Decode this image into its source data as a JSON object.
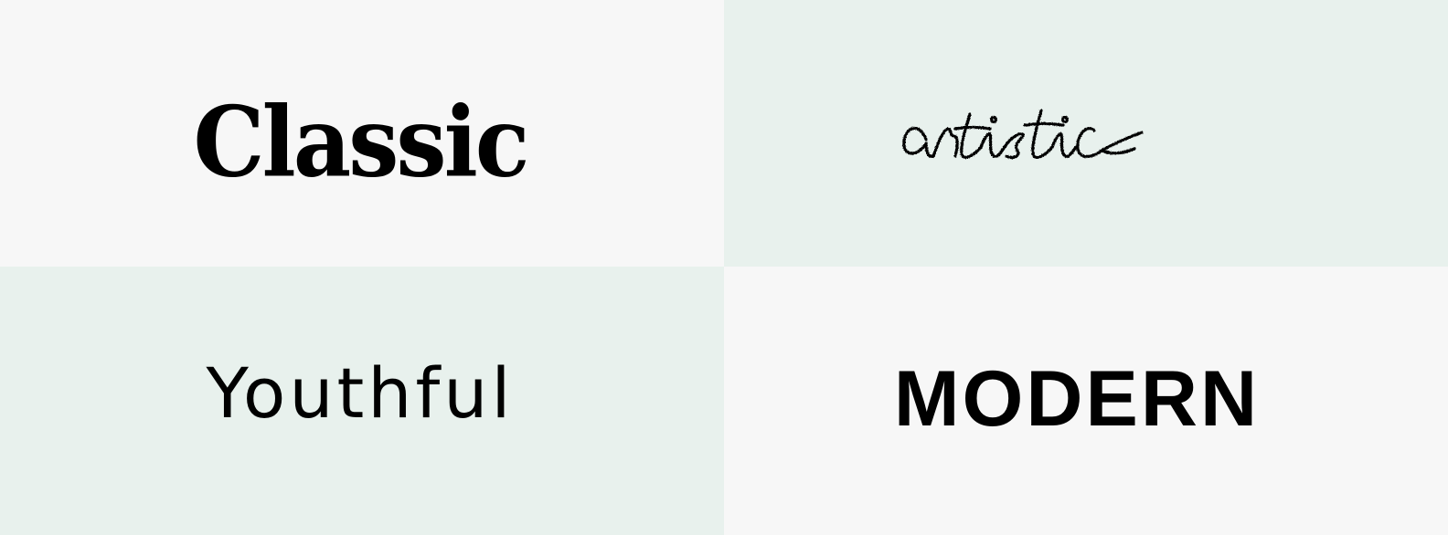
{
  "tiles": {
    "classic": {
      "label": "Classic",
      "background": "#f7f7f7"
    },
    "artistic": {
      "label": "artistic",
      "background": "#e8f1ed"
    },
    "youthful": {
      "label": "Youthful",
      "background": "#e8f1ed"
    },
    "modern": {
      "label": "MODERN",
      "background": "#f7f7f7"
    }
  },
  "colors": {
    "text": "#000000",
    "light_tile": "#f7f7f7",
    "mint_tile": "#e8f1ed"
  }
}
